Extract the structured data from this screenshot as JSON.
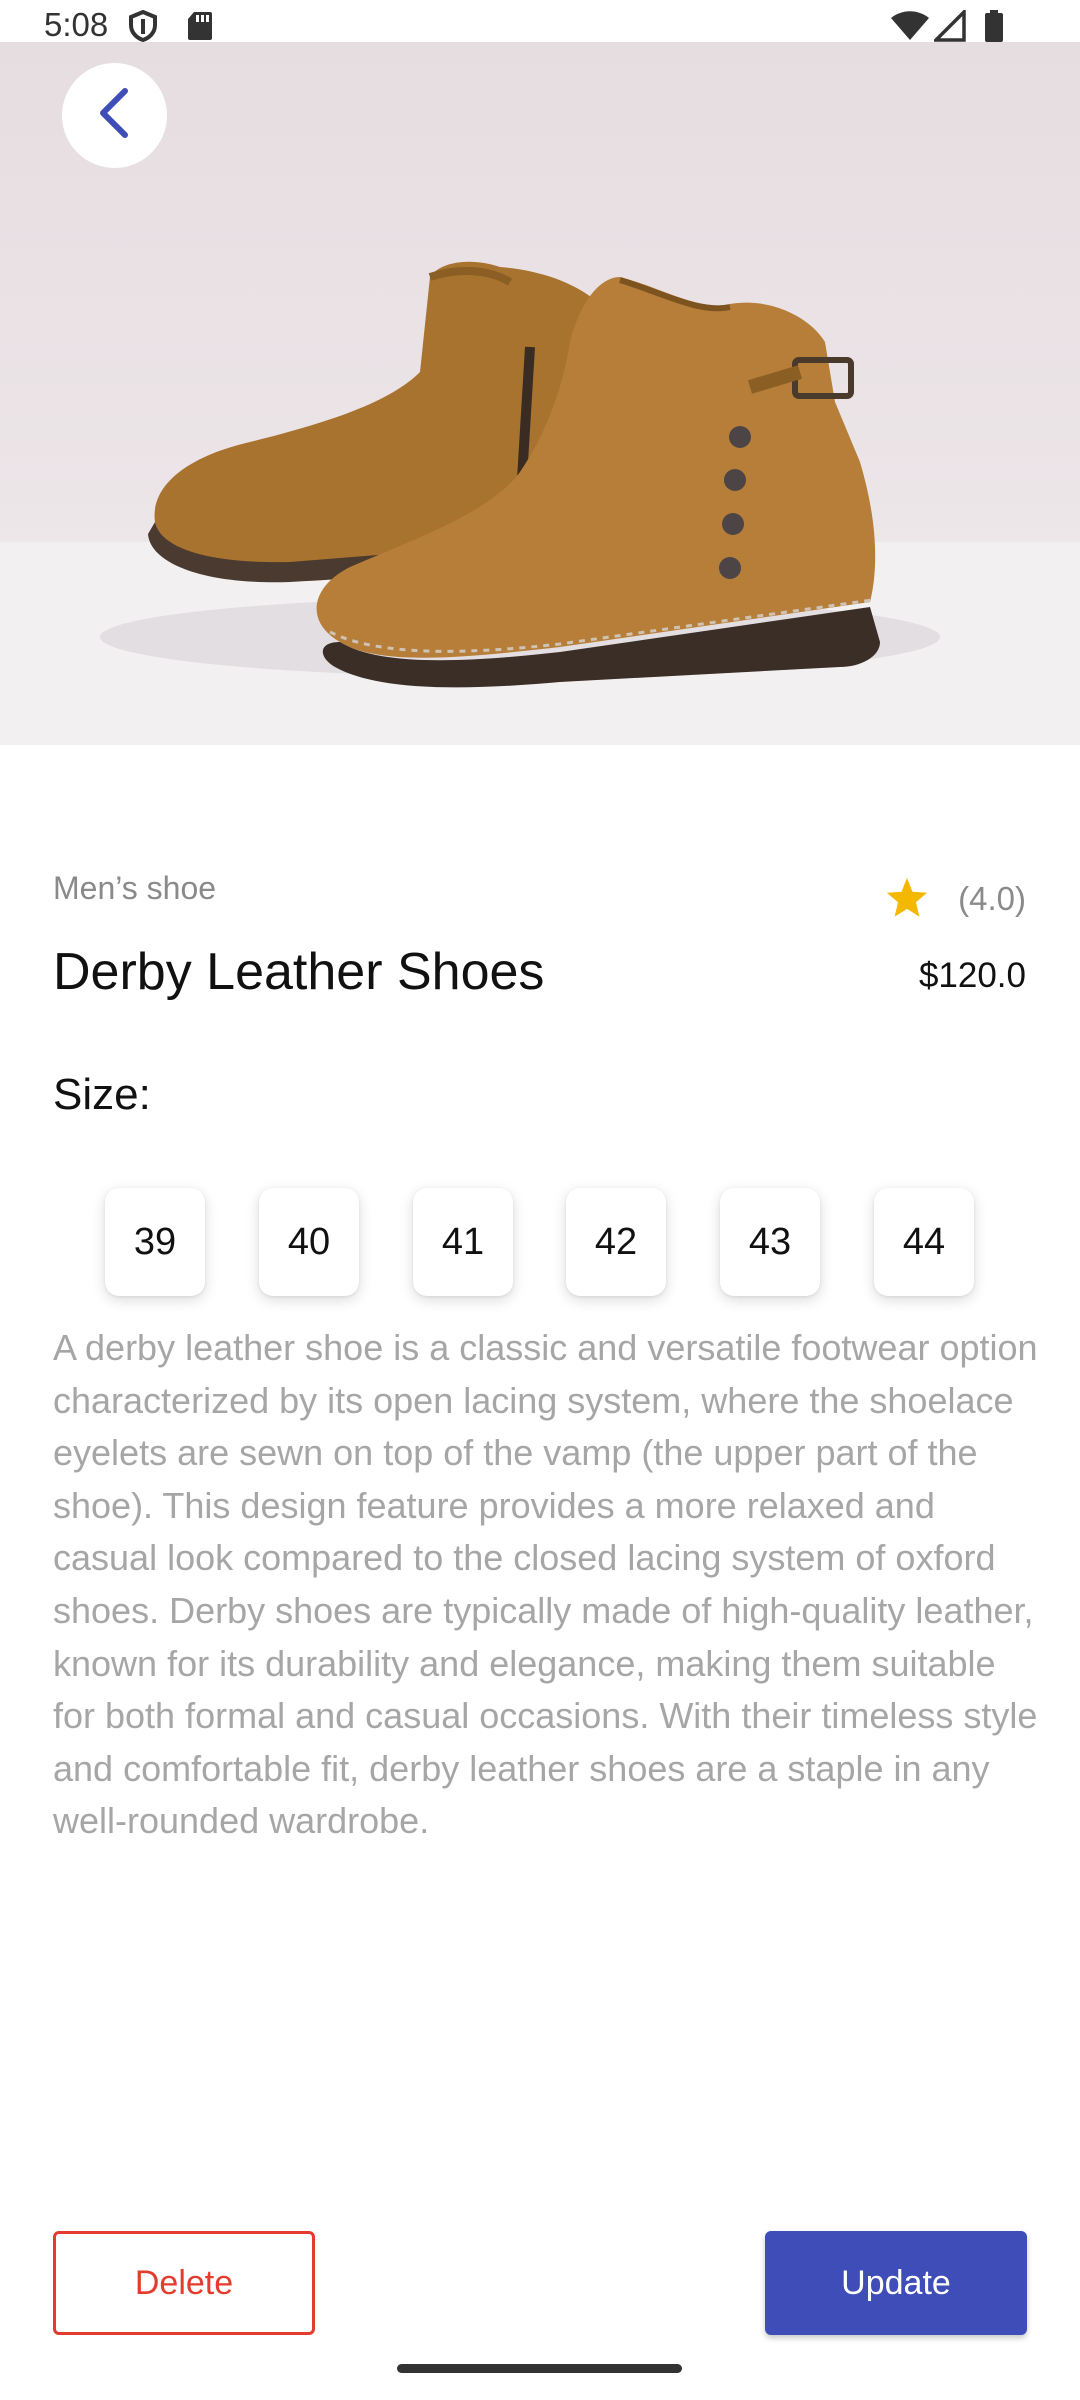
{
  "status_bar": {
    "time": "5:08"
  },
  "navigation": {
    "back_icon": "chevron-left-icon"
  },
  "product": {
    "image_alt": "Brown suede ankle boots",
    "category": "Men’s shoe",
    "rating": "(4.0)",
    "title": "Derby Leather Shoes",
    "price": "$120.0",
    "size_label": "Size:",
    "sizes": [
      "39",
      "40",
      "41",
      "42",
      "43",
      "44"
    ],
    "description": "A derby leather shoe is a classic and versatile footwear option characterized by its open lacing system, where the shoelace eyelets are sewn on top of the vamp (the upper part of the shoe). This design feature provides a more relaxed and casual look compared to the closed lacing system of oxford shoes. Derby shoes are typically made of high-quality leather, known for its durability and elegance, making them suitable for both formal and casual occasions. With their timeless style and comfortable fit, derby leather shoes are a staple in any well-rounded wardrobe."
  },
  "actions": {
    "delete_label": "Delete",
    "update_label": "Update"
  },
  "colors": {
    "accent": "#3F4DB8",
    "danger": "#E33B2E",
    "star": "#F5B800",
    "muted_text": "#A6A6A6"
  }
}
